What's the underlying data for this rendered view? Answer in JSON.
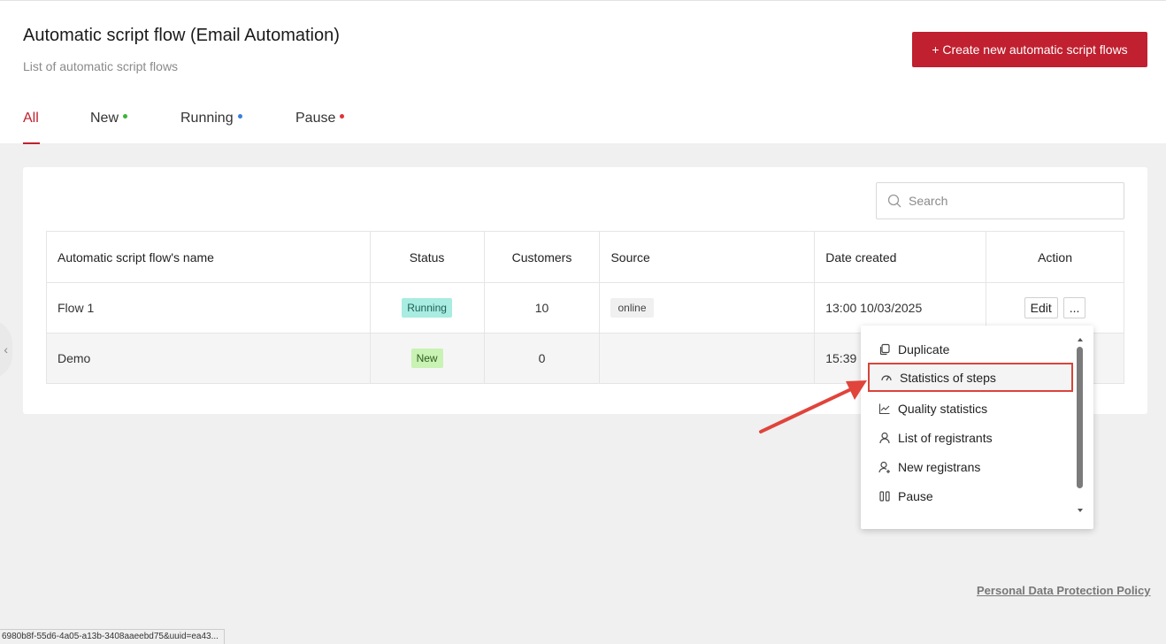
{
  "header": {
    "title": "Automatic script flow (Email Automation)",
    "subtitle": "List of automatic script flows",
    "create_button": "+ Create new automatic script flows"
  },
  "tabs": [
    {
      "label": "All",
      "active": true
    },
    {
      "label": "New",
      "dot_color": "#3cb33c"
    },
    {
      "label": "Running",
      "dot_color": "#3b7de0"
    },
    {
      "label": "Pause",
      "dot_color": "#e0323a"
    }
  ],
  "search": {
    "placeholder": "Search",
    "value": ""
  },
  "table": {
    "headers": [
      "Automatic script flow's name",
      "Status",
      "Customers",
      "Source",
      "Date created",
      "Action"
    ],
    "rows": [
      {
        "name": "Flow 1",
        "status": "Running",
        "customers": "10",
        "source": "online",
        "date": "13:00 10/03/2025",
        "edit": "Edit",
        "more": "..."
      },
      {
        "name": "Demo",
        "status": "New",
        "customers": "0",
        "source": "",
        "date": "15:39",
        "edit": "",
        "more": ""
      }
    ]
  },
  "dropdown": {
    "items": [
      {
        "label": "Duplicate",
        "icon": "copy-icon"
      },
      {
        "label": "Statistics of steps",
        "icon": "gauge-icon",
        "highlighted": true
      },
      {
        "label": "Quality statistics",
        "icon": "line-chart-icon"
      },
      {
        "label": "List of registrants",
        "icon": "user-icon"
      },
      {
        "label": "New registrans",
        "icon": "user-add-icon"
      },
      {
        "label": "Pause",
        "icon": "pause-icon"
      }
    ]
  },
  "footer": {
    "policy_link": "Personal Data Protection Policy",
    "status_url": "6980b8f-55d6-4a05-a13b-3408aaeebd75&uuid=ea43..."
  },
  "colors": {
    "brand": "#c0202f",
    "highlight_border": "#d9443a"
  }
}
